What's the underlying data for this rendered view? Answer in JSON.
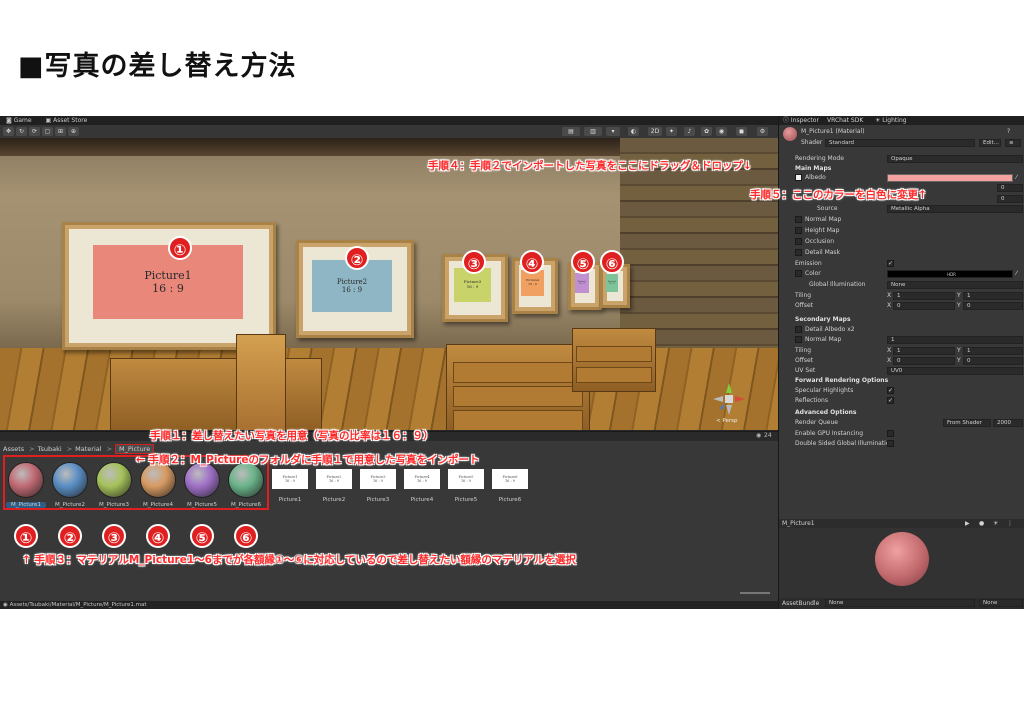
{
  "page_title": "■写真の差し替え方法",
  "scene": {
    "tabs": [
      "Game",
      "Asset Store"
    ],
    "toolbar_2d": "2D",
    "persp_label": "< Persp",
    "pictures": [
      {
        "title": "Picture1",
        "ratio": "16 : 9"
      },
      {
        "title": "Picture2",
        "ratio": "16 : 9"
      },
      {
        "title": "Picture3",
        "ratio": "16 : 9"
      },
      {
        "title": "Picture4",
        "ratio": "16 : 9"
      },
      {
        "title": "Picture5",
        "ratio": "16 : 9"
      },
      {
        "title": "Picture6",
        "ratio": "16 : 9"
      }
    ],
    "picture_colors": [
      "#e8877a",
      "#8fb6c4",
      "#c8d36a",
      "#f0a060",
      "#c090d0",
      "#7ec49a"
    ],
    "frame_numbers": [
      "①",
      "②",
      "③",
      "④",
      "⑤",
      "⑥"
    ]
  },
  "annotations": {
    "step1": "手順１：差し替えたい写真を用意（写真の比率は１６：９）",
    "step2": "← 手順２：M_Pictureのフォルダに手順１で用意した写真をインポート",
    "step3": "↑ 手順３：マテリアルM_Picture1〜6までが各額縁①〜⑥に対応しているので差し替えたい額縁のマテリアルを選択",
    "step4": "手順４：手順２でインポートした写真をここにドラッグ＆ドロップ↓",
    "step5": "手順５：ここのカラーを白色に変更↑"
  },
  "project": {
    "breadcrumb": [
      "Assets",
      "Tsubaki",
      "Material",
      "M_Picture"
    ],
    "item_count": "24",
    "materials": [
      {
        "label": "M_Picture1",
        "color": "#c26a74"
      },
      {
        "label": "M_Picture2",
        "color": "#5a8ec4"
      },
      {
        "label": "M_Picture3",
        "color": "#a6c25a"
      },
      {
        "label": "M_Picture4",
        "color": "#d89a62"
      },
      {
        "label": "M_Picture5",
        "color": "#a070c8"
      },
      {
        "label": "M_Picture6",
        "color": "#6ab48a"
      }
    ],
    "textures": [
      {
        "label": "Picture1",
        "line1": "Picture1",
        "line2": "16 : 9"
      },
      {
        "label": "Picture2",
        "line1": "Picture2",
        "line2": "16 : 9"
      },
      {
        "label": "Picture3",
        "line1": "Picture3",
        "line2": "16 : 9"
      },
      {
        "label": "Picture4",
        "line1": "Picture4",
        "line2": "16 : 9"
      },
      {
        "label": "Picture5",
        "line1": "Picture5",
        "line2": "16 : 9"
      },
      {
        "label": "Picture6",
        "line1": "Picture6",
        "line2": "16 : 9"
      }
    ],
    "circled": [
      "①",
      "②",
      "③",
      "④",
      "⑤",
      "⑥"
    ],
    "status_path": "Assets/Tsubaki/Material/M_Picture/M_Picture1.mat"
  },
  "inspector": {
    "tabs": [
      "Inspector",
      "VRChat SDK",
      "Lighting"
    ],
    "object_name": "M_Picture1 (Material)",
    "shader_label": "Shader",
    "shader_value": "Standard",
    "edit_button": "Edit...",
    "rendering_mode_label": "Rendering Mode",
    "rendering_mode_value": "Opaque",
    "main_maps": "Main Maps",
    "albedo": "Albedo",
    "source_label": "Source",
    "source_value": "Metallic Alpha",
    "normal_map": "Normal Map",
    "height_map": "Height Map",
    "occlusion": "Occlusion",
    "detail_mask": "Detail Mask",
    "emission": "Emission",
    "color": "Color",
    "hdr": "HDR",
    "global_illumination_label": "Global Illumination",
    "global_illumination_value": "None",
    "tiling": "Tiling",
    "offset": "Offset",
    "x": "X",
    "y": "Y",
    "one": "1",
    "zero": "0",
    "secondary_maps": "Secondary Maps",
    "detail_albedo": "Detail Albedo x2",
    "normal_map2_value": "1",
    "uv_set_label": "UV Set",
    "uv_set_value": "UV0",
    "forward_options": "Forward Rendering Options",
    "specular_highlights": "Specular Highlights",
    "reflections": "Reflections",
    "advanced_options": "Advanced Options",
    "render_queue_label": "Render Queue",
    "render_queue_mode": "From Shader",
    "render_queue_value": "2000",
    "gpu_instancing": "Enable GPU Instancing",
    "double_sided_gi": "Double Sided Global Illumination",
    "preview_name": "M_Picture1",
    "assetbundle_label": "AssetBundle",
    "assetbundle_value": "None",
    "assetbundle_variant": "None"
  }
}
